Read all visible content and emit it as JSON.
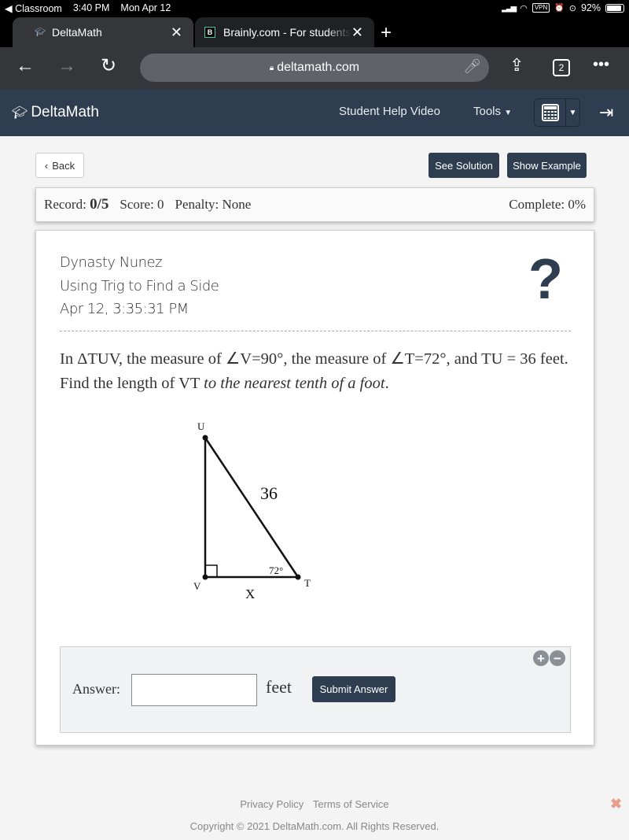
{
  "status_bar": {
    "back_app": "Classroom",
    "time": "3:40 PM",
    "date": "Mon Apr 12",
    "vpn": "VPN",
    "battery": "92%",
    "battery_level": 0.92
  },
  "browser": {
    "tabs": [
      {
        "title": "DeltaMath",
        "active": true,
        "favicon": "graduation-cap-icon"
      },
      {
        "title": "Brainly.com - For students",
        "active": false,
        "favicon": "B"
      }
    ],
    "new_tab": "+",
    "url": "deltamath.com",
    "tab_count": "2"
  },
  "navbar": {
    "logo": "DeltaMath",
    "links": [
      "Student Help Video",
      "Tools"
    ],
    "colors": {
      "brand": "#2e3d4f"
    }
  },
  "actions": {
    "back": "Back",
    "see_solution": "See Solution",
    "show_example": "Show Example"
  },
  "record": {
    "record_label": "Record:",
    "record_value": "0/5",
    "score": "Score: 0",
    "penalty": "Penalty: None",
    "complete": "Complete: 0%"
  },
  "problem": {
    "student": "Dynasty Nunez",
    "topic": "Using Trig to Find a Side",
    "timestamp": "Apr 12, 3:35:31 PM",
    "help_icon": "?",
    "text_main": "In ΔTUV, the measure of ∠V=90°, the measure of ∠T=72°, and TU = 36 feet. Find the length of VT ",
    "text_italic": "to the nearest tenth of a foot",
    "text_end": ".",
    "diagram": {
      "vertex_u": "U",
      "vertex_v": "V",
      "vertex_t": "T",
      "hypotenuse_label": "36",
      "angle_label": "72°",
      "unknown_label": "X"
    }
  },
  "answer": {
    "label": "Answer:",
    "value": "",
    "unit": "feet",
    "submit": "Submit Answer",
    "zoom_in": "+",
    "zoom_out": "−"
  },
  "footer": {
    "privacy": "Privacy Policy",
    "terms": "Terms of Service",
    "copyright": "Copyright © 2021 DeltaMath.com. All Rights Reserved.",
    "close": "✖"
  }
}
